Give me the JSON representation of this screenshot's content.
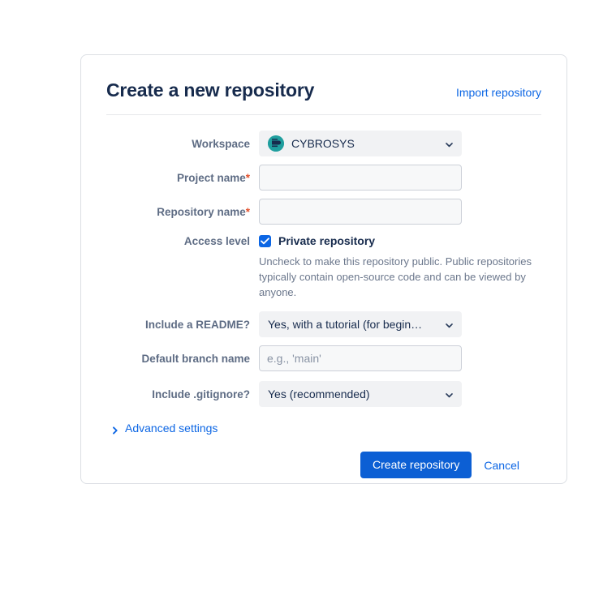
{
  "header": {
    "title": "Create a new repository",
    "import_link": "Import repository"
  },
  "form": {
    "workspace": {
      "label": "Workspace",
      "value": "CYBROSYS",
      "avatar_icon": "workspace-avatar-icon",
      "chevron_icon": "chevron-down-icon"
    },
    "project_name": {
      "label": "Project name",
      "required_marker": "*",
      "value": "",
      "placeholder": ""
    },
    "repository_name": {
      "label": "Repository name",
      "required_marker": "*",
      "value": "",
      "placeholder": ""
    },
    "access_level": {
      "label": "Access level",
      "checkbox_label": "Private repository",
      "checked": true,
      "help_text": "Uncheck to make this repository public. Public repositories typically contain open-source code and can be viewed by anyone.",
      "check_icon": "checkmark-icon"
    },
    "readme": {
      "label": "Include a README?",
      "value": "Yes, with a tutorial (for begin…",
      "chevron_icon": "chevron-down-icon"
    },
    "default_branch": {
      "label": "Default branch name",
      "value": "",
      "placeholder": "e.g., 'main'"
    },
    "gitignore": {
      "label": "Include .gitignore?",
      "value": "Yes (recommended)",
      "chevron_icon": "chevron-down-icon"
    },
    "advanced": {
      "label": "Advanced settings",
      "chevron_icon": "chevron-right-icon"
    }
  },
  "actions": {
    "submit_label": "Create repository",
    "cancel_label": "Cancel"
  },
  "colors": {
    "primary_button": "#0c5fd4",
    "link": "#0c66e4",
    "checkbox": "#0c66e4",
    "required_asterisk": "#e2502c",
    "label_text": "#5e6c84",
    "title_text": "#172b4d",
    "help_text": "#6b778c",
    "card_border": "#dcdfe4",
    "input_fill": "#f7f8f9",
    "select_fill": "#f1f2f4",
    "avatar_bg": "#1f9e9e"
  }
}
